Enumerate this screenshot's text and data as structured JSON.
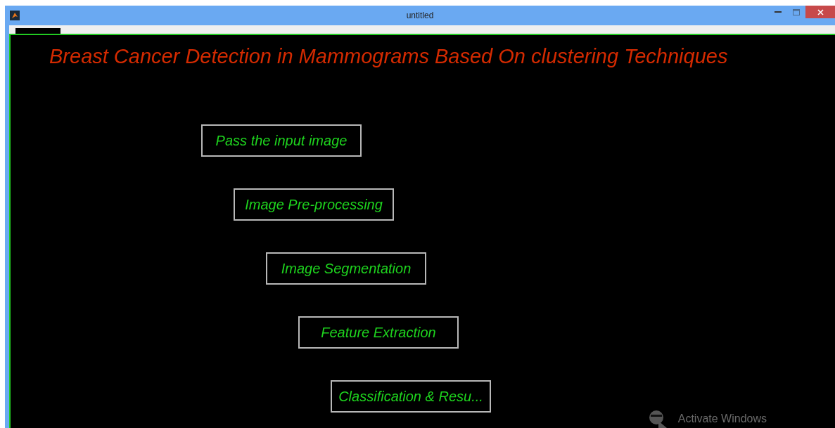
{
  "window": {
    "title": "untitled"
  },
  "heading": "Breast Cancer Detection in Mammograms Based On clustering Techniques",
  "buttons": [
    {
      "label": "Pass the input image"
    },
    {
      "label": "Image Pre-processing"
    },
    {
      "label": "Image Segmentation"
    },
    {
      "label": "Feature Extraction"
    },
    {
      "label": "Classification & Resu..."
    }
  ],
  "activation_notice": "Activate Windows"
}
